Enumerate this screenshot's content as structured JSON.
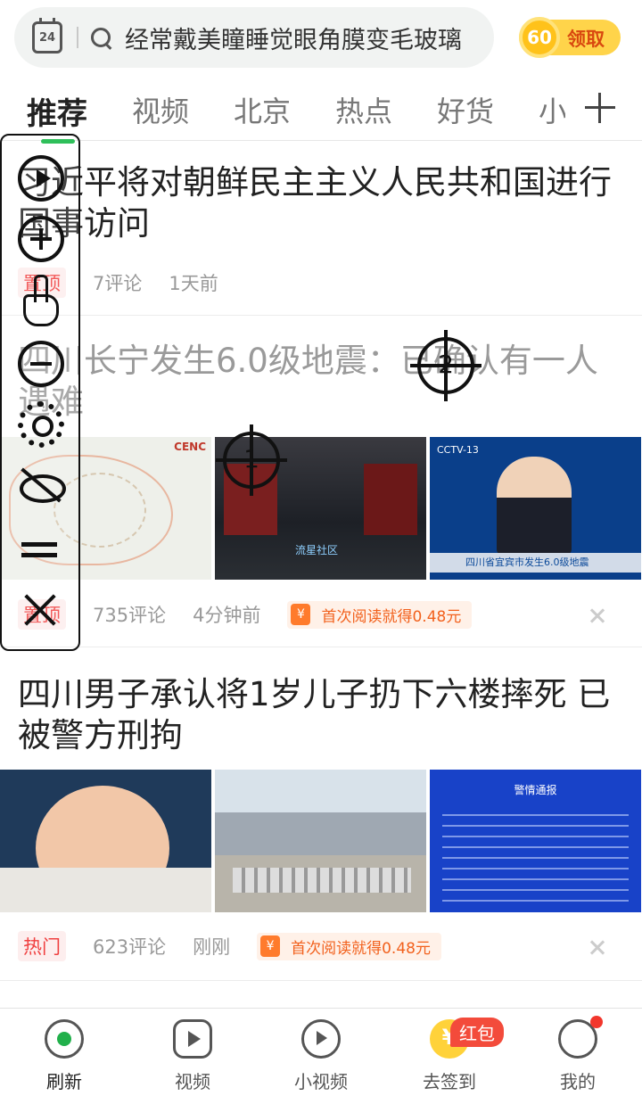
{
  "search": {
    "calendar_day": "24",
    "query": "经常戴美瞳睡觉眼角膜变毛玻璃"
  },
  "reward": {
    "coins": "60",
    "label": "领取"
  },
  "tabs": [
    "推荐",
    "视频",
    "北京",
    "热点",
    "好货",
    "小"
  ],
  "articles": [
    {
      "title": "习近平将对朝鲜民主主义人民共和国进行国事访问",
      "badge": "置顶",
      "comments": "7评论",
      "time": "1天前"
    },
    {
      "title": "四川长宁发生6.0级地震：已确认有一人遇难",
      "badge": "置顶",
      "comments": "735评论",
      "time": "4分钟前",
      "bonus": "首次阅读就得0.48元",
      "thumbs": {
        "map_logo": "CENC",
        "fire_watermark": "流星社区",
        "news_logo": "CCTV-13",
        "news_ticker": "四川省宜宾市发生6.0级地震"
      }
    },
    {
      "title": "四川男子承认将1岁儿子扔下六楼摔死 已被警方刑拘",
      "badge": "热门",
      "comments": "623评论",
      "time": "刚刚",
      "bonus": "首次阅读就得0.48元",
      "thumbs": {
        "notice_title": "警情通报"
      }
    }
  ],
  "nav": {
    "refresh": "刷新",
    "video": "视频",
    "short_video": "小视频",
    "sign_in": "去签到",
    "me": "我的",
    "red_packet": "红包"
  },
  "markers": [
    "1",
    "2"
  ],
  "colors": {
    "accent_green": "#21b04b",
    "coin_yellow": "#ffd44a",
    "badge_red": "#f04040",
    "bonus_orange": "#f2611d"
  }
}
